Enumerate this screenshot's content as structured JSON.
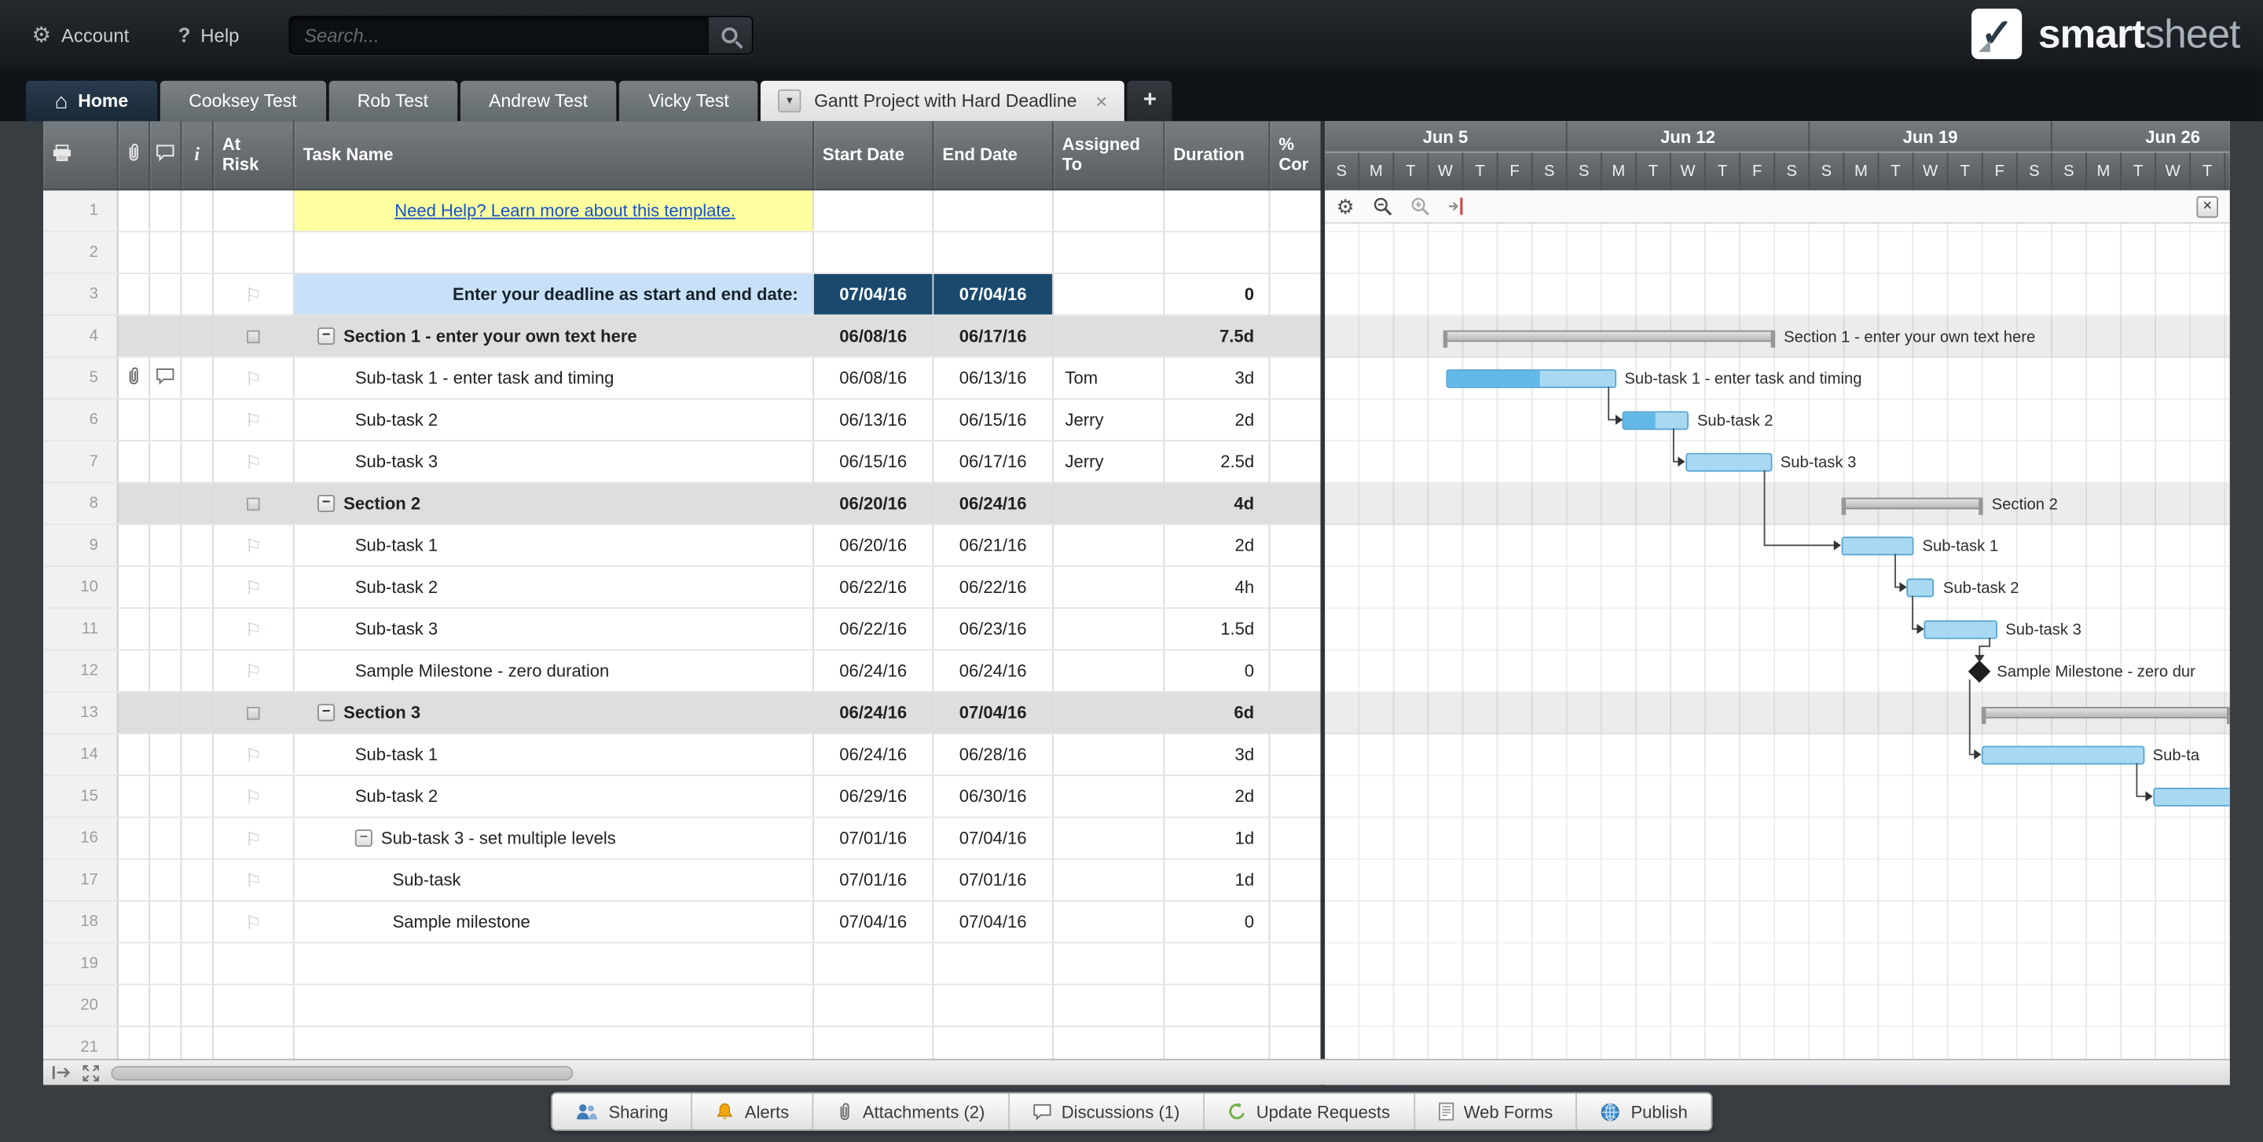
{
  "topbar": {
    "account": "Account",
    "help": "Help",
    "search_placeholder": "Search...",
    "logo": {
      "bold": "smart",
      "light": "sheet"
    }
  },
  "ui": {
    "gear": "⚙",
    "question": "?",
    "check": "✓",
    "home_glyph": "⌂",
    "dropdown": "▼",
    "close": "×",
    "plus": "+",
    "collapse": "−",
    "flag": "⚐",
    "info": "i"
  },
  "tabs": {
    "home": {
      "label": "Home"
    },
    "items": [
      {
        "label": "Cooksey Test"
      },
      {
        "label": "Rob Test"
      },
      {
        "label": "Andrew Test"
      },
      {
        "label": "Vicky Test"
      }
    ],
    "active": {
      "label": "Gantt Project with Hard Deadline"
    }
  },
  "grid": {
    "headers": {
      "at_risk": "At Risk",
      "task_name": "Task Name",
      "start_date": "Start Date",
      "end_date": "End Date",
      "assigned_to": "Assigned To",
      "duration": "Duration",
      "percent": "% Cor"
    },
    "rows": [
      {
        "num": 1,
        "type": "link",
        "task": "Need Help? Learn more about this template."
      },
      {
        "num": 2,
        "type": "empty"
      },
      {
        "num": 3,
        "type": "deadline",
        "task": "Enter your deadline as start and end date:",
        "start": "07/04/16",
        "end": "07/04/16",
        "duration": "0",
        "flag": true
      },
      {
        "num": 4,
        "type": "section",
        "task": "Section 1 - enter your own text here",
        "start": "06/08/16",
        "end": "06/17/16",
        "duration": "7.5d",
        "collapse": true,
        "flag": "box"
      },
      {
        "num": 5,
        "type": "task",
        "indent": 1,
        "task": "Sub-task 1 - enter task and timing",
        "start": "06/08/16",
        "end": "06/13/16",
        "assigned": "Tom",
        "duration": "3d",
        "flag": true,
        "attach": true,
        "comment": true
      },
      {
        "num": 6,
        "type": "task",
        "indent": 1,
        "task": "Sub-task 2",
        "start": "06/13/16",
        "end": "06/15/16",
        "assigned": "Jerry",
        "duration": "2d",
        "flag": true
      },
      {
        "num": 7,
        "type": "task",
        "indent": 1,
        "task": "Sub-task 3",
        "start": "06/15/16",
        "end": "06/17/16",
        "assigned": "Jerry",
        "duration": "2.5d",
        "flag": true
      },
      {
        "num": 8,
        "type": "section",
        "task": "Section 2",
        "start": "06/20/16",
        "end": "06/24/16",
        "duration": "4d",
        "collapse": true,
        "flag": "box"
      },
      {
        "num": 9,
        "type": "task",
        "indent": 1,
        "task": "Sub-task 1",
        "start": "06/20/16",
        "end": "06/21/16",
        "duration": "2d",
        "flag": true
      },
      {
        "num": 10,
        "type": "task",
        "indent": 1,
        "task": "Sub-task 2",
        "start": "06/22/16",
        "end": "06/22/16",
        "duration": "4h",
        "flag": true
      },
      {
        "num": 11,
        "type": "task",
        "indent": 1,
        "task": "Sub-task 3",
        "start": "06/22/16",
        "end": "06/23/16",
        "duration": "1.5d",
        "flag": true
      },
      {
        "num": 12,
        "type": "task",
        "indent": 1,
        "task": "Sample Milestone - zero duration",
        "start": "06/24/16",
        "end": "06/24/16",
        "duration": "0",
        "flag": true
      },
      {
        "num": 13,
        "type": "section",
        "task": "Section 3",
        "start": "06/24/16",
        "end": "07/04/16",
        "duration": "6d",
        "collapse": true,
        "flag": "box"
      },
      {
        "num": 14,
        "type": "task",
        "indent": 1,
        "task": "Sub-task 1",
        "start": "06/24/16",
        "end": "06/28/16",
        "duration": "3d",
        "flag": true
      },
      {
        "num": 15,
        "type": "task",
        "indent": 1,
        "task": "Sub-task 2",
        "start": "06/29/16",
        "end": "06/30/16",
        "duration": "2d",
        "flag": true
      },
      {
        "num": 16,
        "type": "task",
        "indent": 1,
        "task": "Sub-task 3 - set multiple levels",
        "start": "07/01/16",
        "end": "07/04/16",
        "duration": "1d",
        "flag": true,
        "collapse": true
      },
      {
        "num": 17,
        "type": "task",
        "indent": 2,
        "task": "Sub-task",
        "start": "07/01/16",
        "end": "07/01/16",
        "duration": "1d",
        "flag": true
      },
      {
        "num": 18,
        "type": "task",
        "indent": 2,
        "task": "Sample milestone",
        "start": "07/04/16",
        "end": "07/04/16",
        "duration": "0",
        "flag": true
      },
      {
        "num": 19,
        "type": "empty"
      },
      {
        "num": 20,
        "type": "empty"
      },
      {
        "num": 21,
        "type": "empty"
      }
    ]
  },
  "gantt": {
    "weeks": [
      "Jun 5",
      "Jun 12",
      "Jun 19",
      "Jun 26"
    ],
    "day_letters": [
      "S",
      "M",
      "T",
      "W",
      "T",
      "F",
      "S"
    ],
    "section_rows": [
      4,
      8,
      13
    ],
    "bars": [
      {
        "row": 4,
        "type": "summary",
        "start": 3.4,
        "days": 9.6,
        "label": "Section 1 - enter your own text here"
      },
      {
        "row": 5,
        "type": "task",
        "start": 3.5,
        "days": 4.9,
        "progress": 0.55,
        "label": "Sub-task 1 - enter task and timing"
      },
      {
        "row": 6,
        "type": "task",
        "start": 8.6,
        "days": 1.9,
        "progress": 0.5,
        "label": "Sub-task 2"
      },
      {
        "row": 7,
        "type": "task",
        "start": 10.4,
        "days": 2.5,
        "progress": 0,
        "label": "Sub-task 3"
      },
      {
        "row": 8,
        "type": "summary",
        "start": 14.9,
        "days": 4.1,
        "label": "Section 2"
      },
      {
        "row": 9,
        "type": "task",
        "start": 14.9,
        "days": 2.1,
        "progress": 0,
        "label": "Sub-task 1"
      },
      {
        "row": 10,
        "type": "task",
        "start": 16.8,
        "days": 0.8,
        "progress": 0,
        "label": "Sub-task 2"
      },
      {
        "row": 11,
        "type": "task",
        "start": 17.3,
        "days": 2.1,
        "progress": 0,
        "label": "Sub-task 3"
      },
      {
        "row": 12,
        "type": "milestone",
        "start": 18.9,
        "label": "Sample Milestone - zero dur"
      },
      {
        "row": 13,
        "type": "summary",
        "start": 18.95,
        "days": 7.2,
        "label": ""
      },
      {
        "row": 14,
        "type": "task",
        "start": 18.95,
        "days": 4.7,
        "progress": 0,
        "label": "Sub-ta"
      },
      {
        "row": 15,
        "type": "task",
        "start": 23.9,
        "days": 2.3,
        "progress": 0,
        "label": ""
      }
    ],
    "deps": [
      [
        5,
        6
      ],
      [
        6,
        7
      ],
      [
        7,
        9
      ],
      [
        9,
        10
      ],
      [
        10,
        11
      ],
      [
        11,
        12
      ],
      [
        12,
        14
      ],
      [
        14,
        15
      ]
    ]
  },
  "footer": {
    "items": [
      {
        "label": "Sharing",
        "icon": "people"
      },
      {
        "label": "Alerts",
        "icon": "bell"
      },
      {
        "label": "Attachments (2)",
        "icon": "clip"
      },
      {
        "label": "Discussions (1)",
        "icon": "bubble"
      },
      {
        "label": "Update Requests",
        "icon": "update"
      },
      {
        "label": "Web Forms",
        "icon": "form"
      },
      {
        "label": "Publish",
        "icon": "globe"
      }
    ]
  }
}
